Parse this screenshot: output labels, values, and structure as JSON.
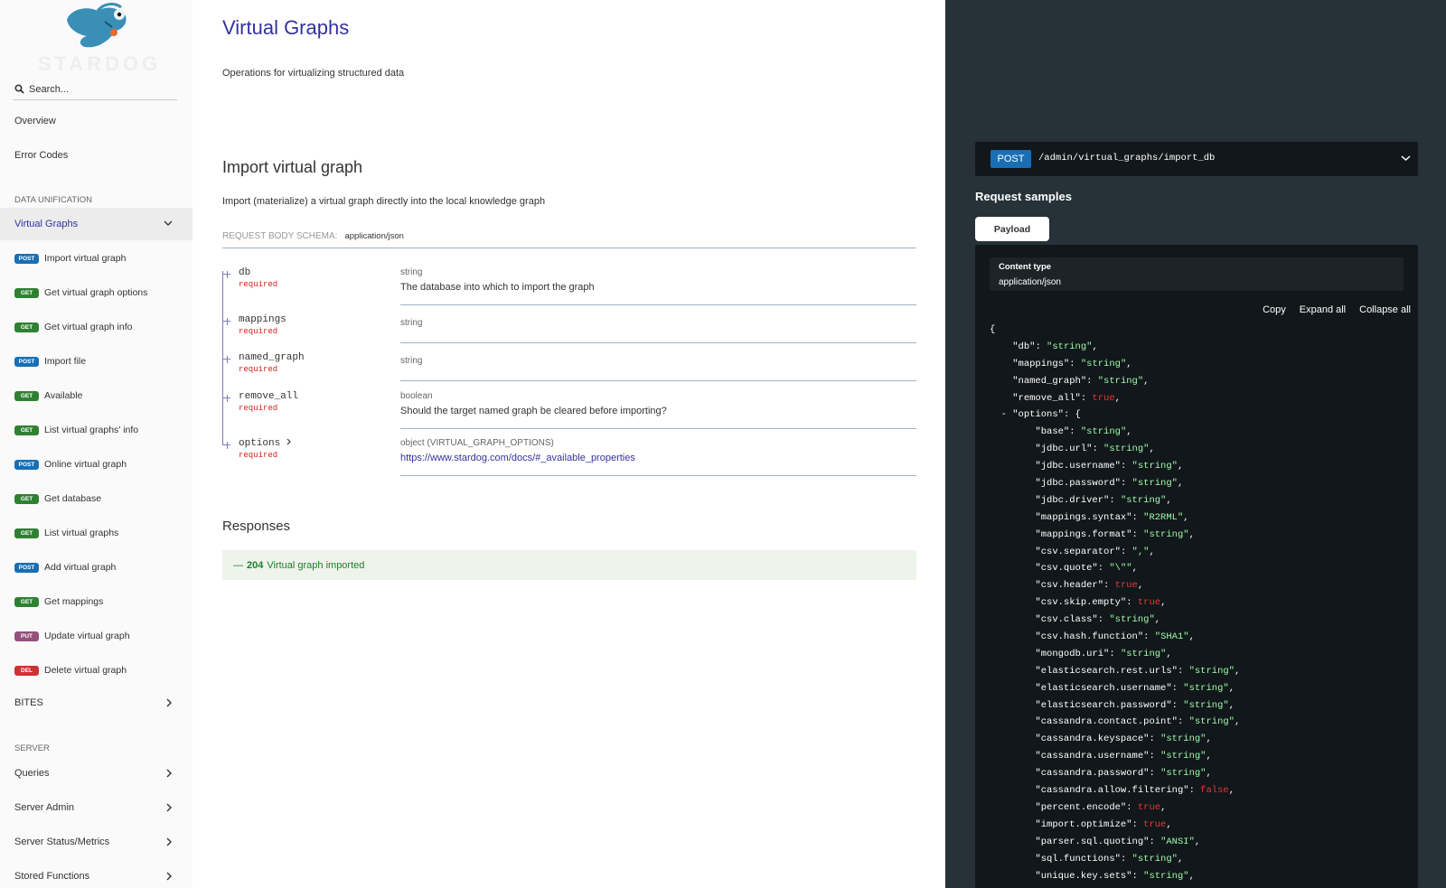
{
  "sidebar": {
    "logo_text": "STARDOG",
    "search_placeholder": "Search...",
    "top_items": [
      "Overview",
      "Error Codes"
    ],
    "section_data_unification": "DATA UNIFICATION",
    "active_group": "Virtual Graphs",
    "operations": [
      {
        "method": "POST",
        "label": "Import virtual graph"
      },
      {
        "method": "GET",
        "label": "Get virtual graph options"
      },
      {
        "method": "GET",
        "label": "Get virtual graph info"
      },
      {
        "method": "POST",
        "label": "Import file"
      },
      {
        "method": "GET",
        "label": "Available"
      },
      {
        "method": "GET",
        "label": "List virtual graphs' info"
      },
      {
        "method": "POST",
        "label": "Online virtual graph"
      },
      {
        "method": "GET",
        "label": "Get database"
      },
      {
        "method": "GET",
        "label": "List virtual graphs"
      },
      {
        "method": "POST",
        "label": "Add virtual graph"
      },
      {
        "method": "GET",
        "label": "Get mappings"
      },
      {
        "method": "PUT",
        "label": "Update virtual graph"
      },
      {
        "method": "DEL",
        "label": "Delete virtual graph"
      }
    ],
    "bites": "BITES",
    "section_server": "SERVER",
    "server_items": [
      "Queries",
      "Server Admin",
      "Server Status/Metrics",
      "Stored Functions"
    ]
  },
  "main": {
    "title": "Virtual Graphs",
    "description": "Operations for virtualizing structured data",
    "operation_title": "Import virtual graph",
    "operation_description": "Import (materialize) a virtual graph directly into the local knowledge graph",
    "schema_label": "REQUEST BODY SCHEMA:",
    "schema_type": "application/json",
    "params": [
      {
        "name": "db",
        "required": "required",
        "type": "string",
        "desc": "The database into which to import the graph"
      },
      {
        "name": "mappings",
        "required": "required",
        "type": "string",
        "desc": ""
      },
      {
        "name": "named_graph",
        "required": "required",
        "type": "string",
        "desc": ""
      },
      {
        "name": "remove_all",
        "required": "required",
        "type": "boolean",
        "desc": "Should the target named graph be cleared before importing?"
      },
      {
        "name": "options",
        "required": "required",
        "type": "object (VIRTUAL_GRAPH_OPTIONS)",
        "desc": "https://www.stardog.com/docs/#_available_properties"
      }
    ],
    "responses_title": "Responses",
    "response_204": {
      "code": "204",
      "text": "Virtual graph imported"
    }
  },
  "right": {
    "method": "POST",
    "path": "/admin/virtual_graphs/import_db",
    "request_samples": "Request samples",
    "payload_tab": "Payload",
    "content_type_label": "Content type",
    "content_type_value": "application/json",
    "actions": [
      "Copy",
      "Expand all",
      "Collapse all"
    ]
  },
  "colors": {
    "accent": "#32329f",
    "post": "#186fb5",
    "get": "#2f8132",
    "put": "#95507c",
    "del": "#cc3333",
    "json_string": "#a0fbaa",
    "json_bool": "#e53935"
  }
}
